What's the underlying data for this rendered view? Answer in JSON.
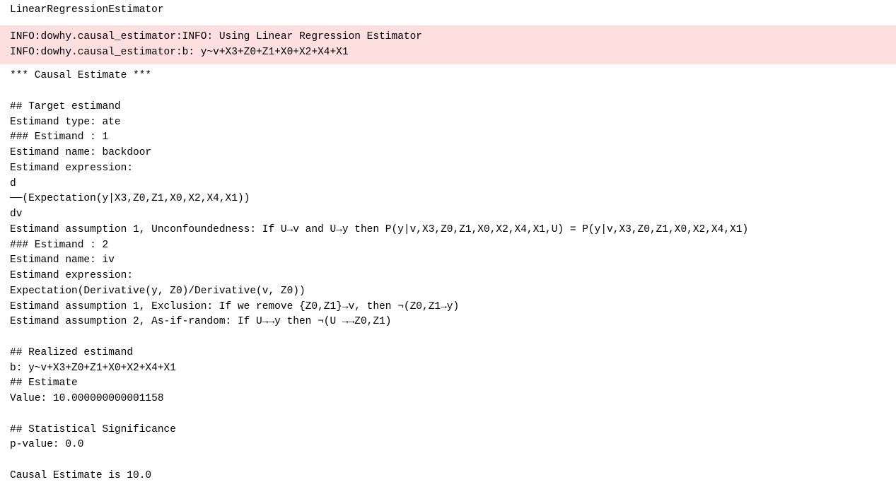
{
  "header": "LinearRegressionEstimator",
  "info_lines": "INFO:dowhy.causal_estimator:INFO: Using Linear Regression Estimator\nINFO:dowhy.causal_estimator:b: y~v+X3+Z0+Z1+X0+X2+X4+X1",
  "output_text": "*** Causal Estimate ***\n\n## Target estimand\nEstimand type: ate\n### Estimand : 1\nEstimand name: backdoor\nEstimand expression:\nd\n──(Expectation(y|X3,Z0,Z1,X0,X2,X4,X1))\ndv\nEstimand assumption 1, Unconfoundedness: If U→v and U→y then P(y|v,X3,Z0,Z1,X0,X2,X4,X1,U) = P(y|v,X3,Z0,Z1,X0,X2,X4,X1)\n### Estimand : 2\nEstimand name: iv\nEstimand expression:\nExpectation(Derivative(y, Z0)/Derivative(v, Z0))\nEstimand assumption 1, Exclusion: If we remove {Z0,Z1}→v, then ¬(Z0,Z1→y)\nEstimand assumption 2, As-if-random: If U→→y then ¬(U →→Z0,Z1)\n\n## Realized estimand\nb: y~v+X3+Z0+Z1+X0+X2+X4+X1\n## Estimate\nValue: 10.000000000001158\n\n## Statistical Significance\np-value: 0.0\n\nCausal Estimate is 10.0"
}
